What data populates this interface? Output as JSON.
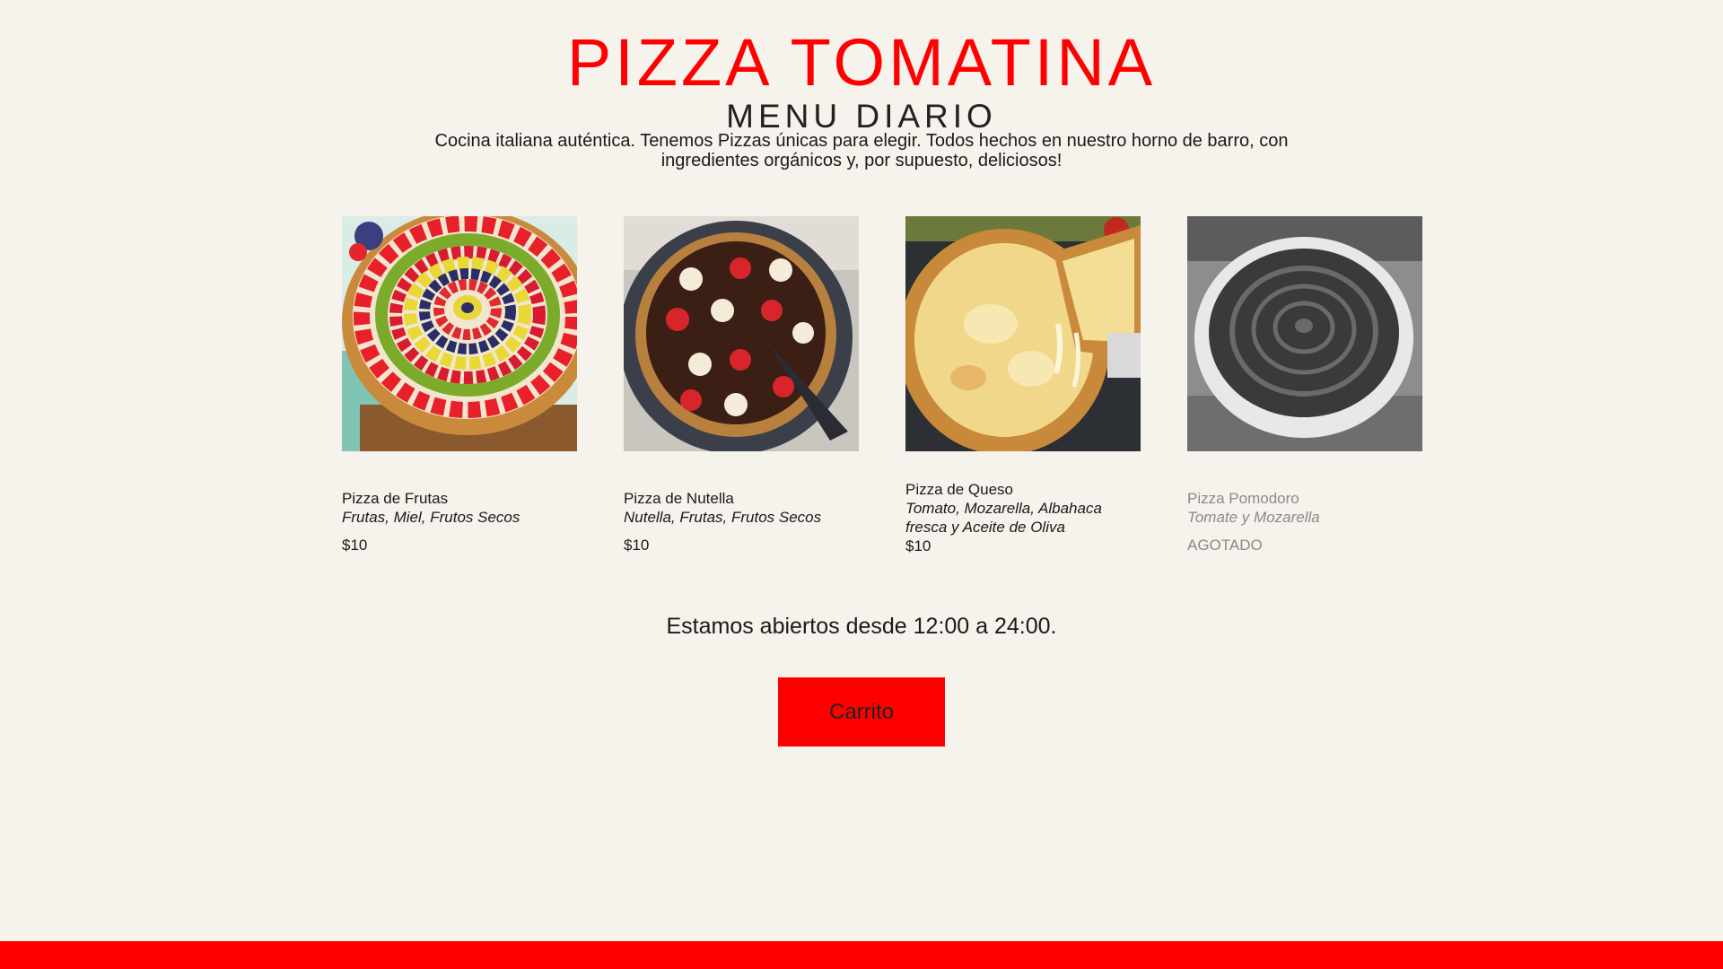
{
  "header": {
    "title": "PIZZA TOMATINA",
    "subtitle": "MENU DIARIO",
    "description": "Cocina italiana auténtica. Tenemos Pizzas únicas para elegir. Todos hechos en nuestro horno de barro, con ingredientes orgánicos y, por supuesto, deliciosos!"
  },
  "menu": {
    "items": [
      {
        "name": "Pizza de Frutas",
        "ingredients": "Frutas, Miel, Frutos Secos",
        "price": "$10",
        "available": true
      },
      {
        "name": "Pizza de Nutella",
        "ingredients": "Nutella, Frutas, Frutos Secos",
        "price": "$10",
        "available": true
      },
      {
        "name": "Pizza de Queso",
        "ingredients": "Tomato, Mozarella, Albahaca fresca y Aceite de Oliva",
        "price": "$10",
        "available": true
      },
      {
        "name": "Pizza Pomodoro",
        "ingredients": "Tomate y Mozarella",
        "price": "AGOTADO",
        "available": false
      }
    ]
  },
  "hours": "Estamos abiertos desde 12:00 a 24:00.",
  "cart_button": {
    "label": "Carrito"
  },
  "colors": {
    "accent": "#ff0000",
    "background": "#f6f2ec",
    "text": "#1a1a1a",
    "soldout_text": "#8a8a8a"
  }
}
